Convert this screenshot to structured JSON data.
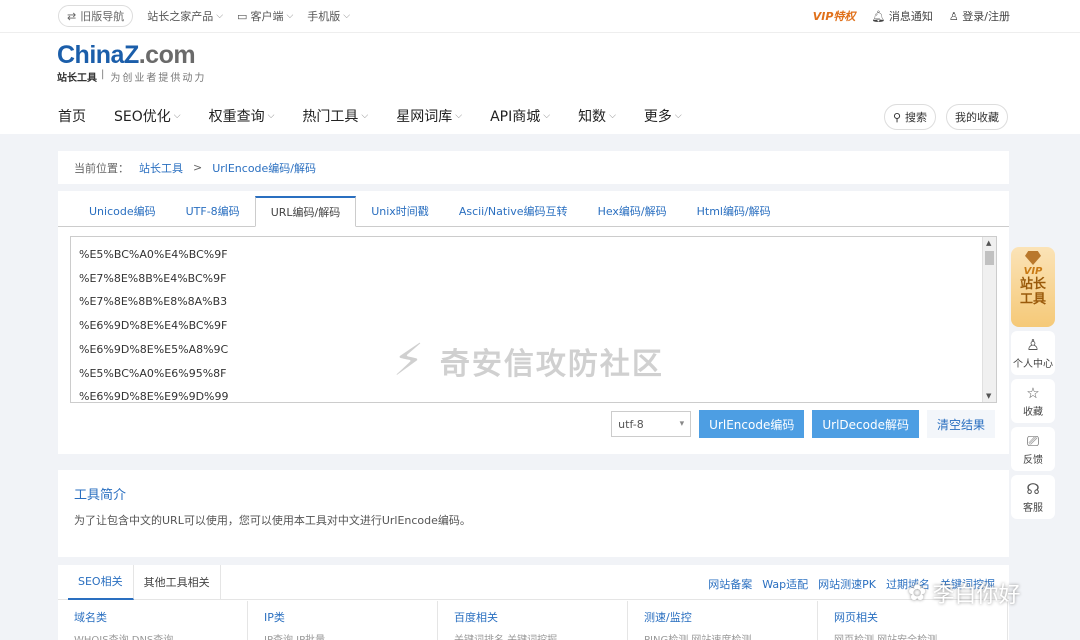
{
  "topbar": {
    "old_nav": "旧版导航",
    "products": "站长之家产品",
    "client": "客户端",
    "mobile": "手机版",
    "vip": "VIP特权",
    "notify": "消息通知",
    "login": "登录/注册"
  },
  "logo": {
    "brand_a": "China",
    "brand_z": "Z",
    "brand_b": ".com",
    "tool": "站长工具",
    "slogan": "为创业者提供动力"
  },
  "nav": [
    "首页",
    "SEO优化",
    "权重查询",
    "热门工具",
    "星网词库",
    "API商城",
    "知数",
    "更多"
  ],
  "nav_has_chevron": [
    false,
    true,
    true,
    true,
    true,
    true,
    true,
    true
  ],
  "search_label": "搜索",
  "favorites_label": "我的收藏",
  "breadcrumb": {
    "prefix": "当前位置：",
    "home": "站长工具",
    "sep": ">",
    "current": "UrlEncode编码/解码"
  },
  "tabs": [
    "Unicode编码",
    "UTF-8编码",
    "URL编码/解码",
    "Unix时间戳",
    "Ascii/Native编码互转",
    "Hex编码/解码",
    "Html编码/解码"
  ],
  "active_tab": 2,
  "editor_lines": [
    "%E5%BC%A0%E4%BC%9F",
    "%E7%8E%8B%E4%BC%9F",
    "%E7%8E%8B%E8%8A%B3",
    "%E6%9D%8E%E4%BC%9F",
    "%E6%9D%8E%E5%A8%9C",
    "%E5%BC%A0%E6%95%8F",
    "%E6%9D%8E%E9%9D%99"
  ],
  "watermark": "奇安信攻防社区",
  "actions": {
    "encoding": "utf-8",
    "encode": "UrlEncode编码",
    "decode": "UrlDecode解码",
    "clear": "清空结果"
  },
  "intro": {
    "title": "工具简介",
    "text": "为了让包含中文的URL可以使用，您可以使用本工具对中文进行UrlEncode编码。"
  },
  "bottom": {
    "tabs": [
      "SEO相关",
      "其他工具相关"
    ],
    "links": [
      "网站备案",
      "Wap适配",
      "网站测速PK",
      "过期域名",
      "关键词挖掘"
    ],
    "cols": [
      {
        "h": "域名类",
        "s": "WHOIS查询    DNS查询"
      },
      {
        "h": "IP类",
        "s": "IP查询    IP批量"
      },
      {
        "h": "百度相关",
        "s": "关键词排名    关键词挖掘"
      },
      {
        "h": "测速/监控",
        "s": "PING检测    网站速度检测"
      },
      {
        "h": "网页相关",
        "s": "网页检测    网站安全检测"
      }
    ]
  },
  "sidebar": {
    "vip_top": "VIP",
    "vip_mid": "站长",
    "vip_bot": "工具",
    "items": [
      "个人中心",
      "收藏",
      "反馈",
      "客服"
    ]
  },
  "footer_watermark": "李白你好"
}
